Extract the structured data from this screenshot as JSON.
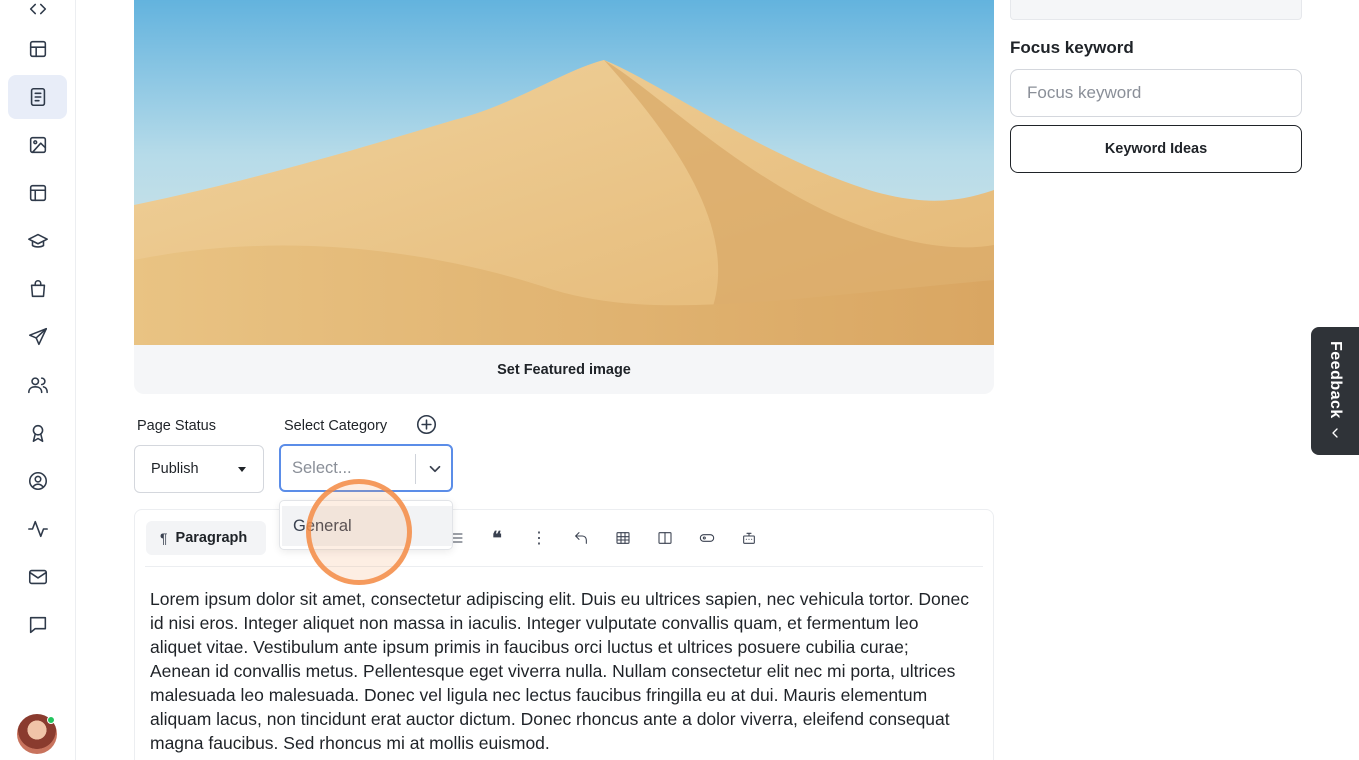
{
  "sidebar": {
    "items": [
      {
        "name": "dashboard",
        "icon": "layout-icon"
      },
      {
        "name": "pages",
        "icon": "document-icon"
      },
      {
        "name": "media",
        "icon": "image-icon"
      },
      {
        "name": "templates",
        "icon": "template-icon"
      },
      {
        "name": "courses",
        "icon": "graduation-cap-icon"
      },
      {
        "name": "shop",
        "icon": "shopping-bag-icon"
      },
      {
        "name": "campaigns",
        "icon": "send-icon"
      },
      {
        "name": "users",
        "icon": "users-icon"
      },
      {
        "name": "badges",
        "icon": "award-icon"
      },
      {
        "name": "account",
        "icon": "user-circle-icon"
      },
      {
        "name": "analytics",
        "icon": "activity-icon"
      },
      {
        "name": "mail",
        "icon": "mail-icon"
      },
      {
        "name": "comments",
        "icon": "chat-icon"
      }
    ],
    "active_item": "pages"
  },
  "featured": {
    "set_label": "Set Featured image"
  },
  "page_status": {
    "label": "Page Status",
    "value": "Publish"
  },
  "category": {
    "label": "Select Category",
    "placeholder": "Select...",
    "options": [
      "General"
    ]
  },
  "toolbar": {
    "block_type": "Paragraph"
  },
  "editor": {
    "body": "Lorem ipsum dolor sit amet, consectetur adipiscing elit. Duis eu ultrices sapien, nec vehicula tortor. Donec id nisi eros. Integer aliquet non massa in iaculis. Integer vulputate convallis quam, et fermentum leo aliquet vitae. Vestibulum ante ipsum primis in faucibus orci luctus et ultrices posuere cubilia curae; Aenean id convallis metus. Pellentesque eget viverra nulla. Nullam consectetur elit nec mi porta, ultrices malesuada leo malesuada. Donec vel ligula nec lectus faucibus fringilla eu at dui. Mauris elementum aliquam lacus, non tincidunt erat auctor dictum. Donec rhoncus ante a dolor viverra, eleifend consequat magna faucibus. Sed rhoncus mi at mollis euismod."
  },
  "seo": {
    "focus_title": "Focus keyword",
    "focus_placeholder": "Focus keyword",
    "keyword_ideas_label": "Keyword Ideas"
  },
  "feedback": {
    "label": "Feedback"
  }
}
